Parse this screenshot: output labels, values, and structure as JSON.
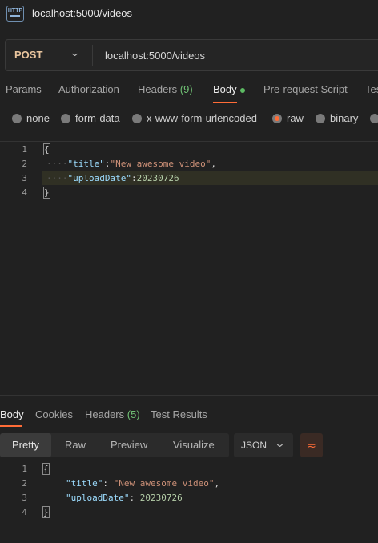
{
  "window": {
    "title": "localhost:5000/videos",
    "icon": "http-file-icon",
    "icon_text": "HTTP"
  },
  "request": {
    "method": "POST",
    "url": "localhost:5000/videos",
    "tabs": [
      {
        "label": "Params"
      },
      {
        "label": "Authorization"
      },
      {
        "label": "Headers",
        "count": "(9)"
      },
      {
        "label": "Body",
        "active": true
      },
      {
        "label": "Pre-request Script"
      },
      {
        "label": "Tes"
      }
    ],
    "body_modes": [
      "none",
      "form-data",
      "x-www-form-urlencoded",
      "raw",
      "binary"
    ],
    "selected_mode": "raw",
    "editor": {
      "line_numbers": [
        "1",
        "2",
        "3",
        "4"
      ],
      "lines": [
        "{",
        "\"title\":\"New awesome video\",",
        "\"uploadDate\":20230726",
        "}"
      ]
    }
  },
  "response": {
    "tabs": [
      {
        "label": "Body",
        "active": true
      },
      {
        "label": "Cookies"
      },
      {
        "label": "Headers",
        "count": "(5)"
      },
      {
        "label": "Test Results"
      }
    ],
    "view_modes": [
      "Pretty",
      "Raw",
      "Preview",
      "Visualize"
    ],
    "selected_view": "Pretty",
    "format": "JSON",
    "wrap_icon": "wrap-lines-icon",
    "line_numbers": [
      "1",
      "2",
      "3",
      "4"
    ],
    "lines": [
      "{",
      "\"title\": \"New awesome video\",",
      "\"uploadDate\": 20230726",
      "}"
    ]
  },
  "colors": {
    "accent": "#ff6c37",
    "success": "#5dbb63",
    "method": "#e8c49d"
  }
}
